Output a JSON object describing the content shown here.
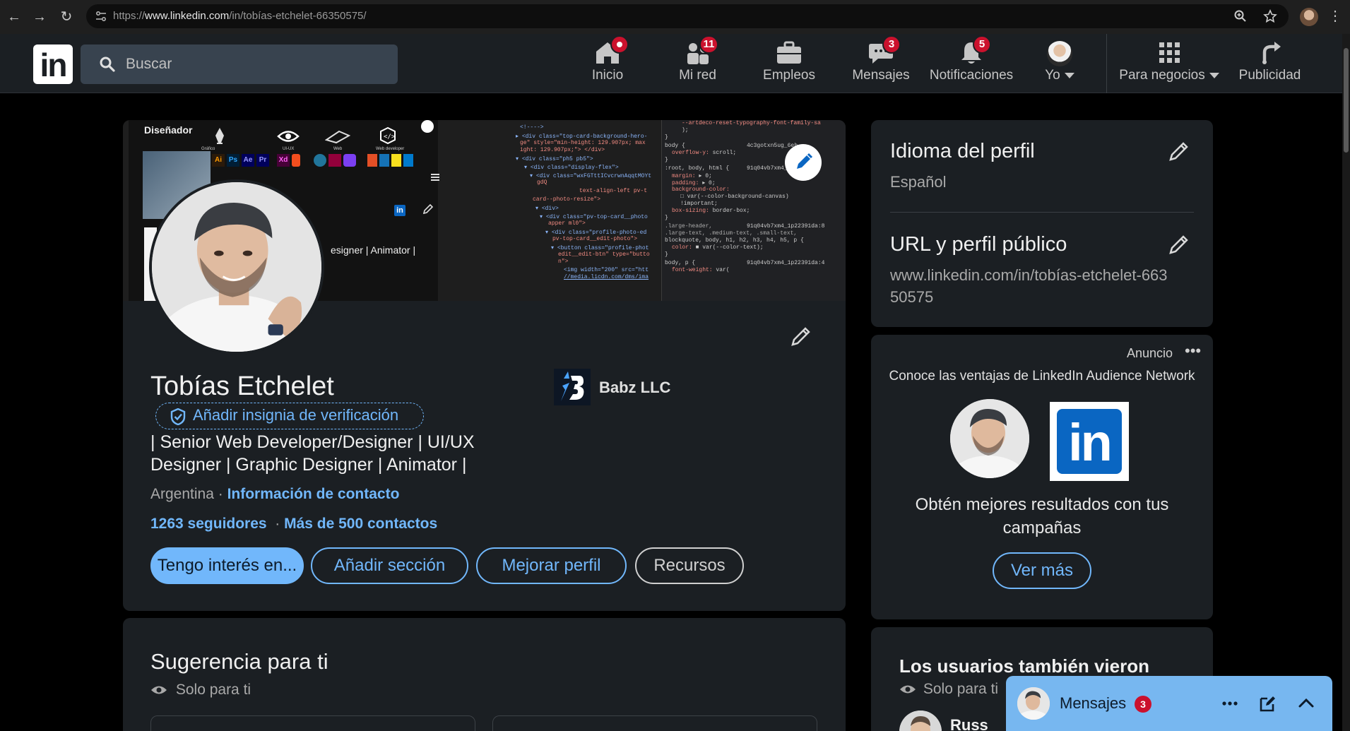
{
  "browser": {
    "url_prefix": "https://",
    "url_host": "www.linkedin.com",
    "url_path": "/in/tobías-etchelet-66350575/"
  },
  "nav": {
    "search_placeholder": "Buscar",
    "items": [
      {
        "label": "Inicio",
        "icon": "home-icon",
        "badge": ""
      },
      {
        "label": "Mi red",
        "icon": "network-icon",
        "badge": "11"
      },
      {
        "label": "Empleos",
        "icon": "briefcase-icon",
        "badge": ""
      },
      {
        "label": "Mensajes",
        "icon": "messaging-icon",
        "badge": "3"
      },
      {
        "label": "Notificaciones",
        "icon": "bell-icon",
        "badge": "5"
      },
      {
        "label": "Yo",
        "icon": "avatar",
        "badge": ""
      },
      {
        "label": "Para negocios",
        "icon": "grid-icon",
        "badge": ""
      },
      {
        "label": "Publicidad",
        "icon": "advertise-icon",
        "badge": ""
      }
    ]
  },
  "banner": {
    "role": "Diseñador",
    "tool_labels": [
      "Gráfico",
      "UI-UX",
      "Web",
      "Web developer"
    ],
    "overlay_text": "esigner | Animator |"
  },
  "profile": {
    "name": "Tobías Etchelet",
    "verify_label": "Añadir insignia de verificación",
    "headline": "| Senior Web Developer/Designer | UI/UX Designer | Graphic Designer | Animator |",
    "location": "Argentina",
    "location_sep": " · ",
    "contact_info": "Información de contacto",
    "followers": "1263 seguidores",
    "conn_sep": "  · ",
    "connections": "Más de 500 contactos",
    "company": "Babz LLC",
    "buttons": {
      "open_to": "Tengo interés en...",
      "add_section": "Añadir sección",
      "enhance": "Mejorar perfil",
      "resources": "Recursos"
    }
  },
  "suggestions": {
    "title": "Sugerencia para ti",
    "subtitle": "Solo para ti"
  },
  "sidebar": {
    "language_title": "Idioma del perfil",
    "language_value": "Español",
    "url_title": "URL y perfil público",
    "url_value": "www.linkedin.com/in/tobías-etchelet-66350575"
  },
  "ad": {
    "label": "Anuncio",
    "headline": "Conoce las ventajas de LinkedIn Audience Network",
    "body": "Obtén mejores resultados con tus campañas",
    "cta": "Ver más",
    "logo_text": "in"
  },
  "viewed": {
    "title": "Los usuarios también vieron",
    "subtitle": "Solo para ti",
    "first_name": "Russ"
  },
  "messaging": {
    "label": "Mensajes",
    "badge": "3"
  },
  "colors": {
    "accent": "#71b7fb",
    "card_bg": "#1b1f23",
    "badge_red": "#cb112d",
    "linkedin_blue": "#0a66c2"
  }
}
